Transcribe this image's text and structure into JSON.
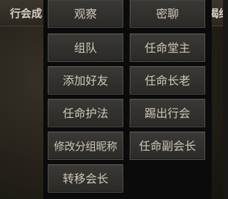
{
  "background_tabs": {
    "left_label": "行会成",
    "right_label": "揭结"
  },
  "menu": {
    "items": [
      {
        "label": "观察"
      },
      {
        "label": "密聊"
      },
      {
        "label": "组队"
      },
      {
        "label": "任命堂主"
      },
      {
        "label": "添加好友"
      },
      {
        "label": "任命长老"
      },
      {
        "label": "任命护法"
      },
      {
        "label": "踢出行会"
      },
      {
        "label": "修改分组昵称"
      },
      {
        "label": "任命副会长"
      },
      {
        "label": "转移会长"
      }
    ]
  }
}
